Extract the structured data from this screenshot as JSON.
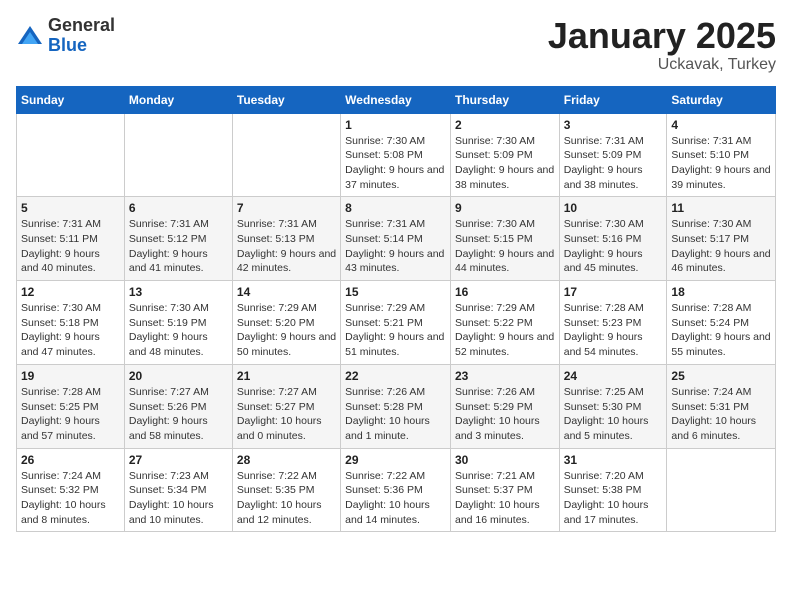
{
  "logo": {
    "general": "General",
    "blue": "Blue"
  },
  "title": "January 2025",
  "subtitle": "Uckavak, Turkey",
  "days_of_week": [
    "Sunday",
    "Monday",
    "Tuesday",
    "Wednesday",
    "Thursday",
    "Friday",
    "Saturday"
  ],
  "weeks": [
    [
      {
        "day": "",
        "info": ""
      },
      {
        "day": "",
        "info": ""
      },
      {
        "day": "",
        "info": ""
      },
      {
        "day": "1",
        "info": "Sunrise: 7:30 AM\nSunset: 5:08 PM\nDaylight: 9 hours and 37 minutes."
      },
      {
        "day": "2",
        "info": "Sunrise: 7:30 AM\nSunset: 5:09 PM\nDaylight: 9 hours and 38 minutes."
      },
      {
        "day": "3",
        "info": "Sunrise: 7:31 AM\nSunset: 5:09 PM\nDaylight: 9 hours and 38 minutes."
      },
      {
        "day": "4",
        "info": "Sunrise: 7:31 AM\nSunset: 5:10 PM\nDaylight: 9 hours and 39 minutes."
      }
    ],
    [
      {
        "day": "5",
        "info": "Sunrise: 7:31 AM\nSunset: 5:11 PM\nDaylight: 9 hours and 40 minutes."
      },
      {
        "day": "6",
        "info": "Sunrise: 7:31 AM\nSunset: 5:12 PM\nDaylight: 9 hours and 41 minutes."
      },
      {
        "day": "7",
        "info": "Sunrise: 7:31 AM\nSunset: 5:13 PM\nDaylight: 9 hours and 42 minutes."
      },
      {
        "day": "8",
        "info": "Sunrise: 7:31 AM\nSunset: 5:14 PM\nDaylight: 9 hours and 43 minutes."
      },
      {
        "day": "9",
        "info": "Sunrise: 7:30 AM\nSunset: 5:15 PM\nDaylight: 9 hours and 44 minutes."
      },
      {
        "day": "10",
        "info": "Sunrise: 7:30 AM\nSunset: 5:16 PM\nDaylight: 9 hours and 45 minutes."
      },
      {
        "day": "11",
        "info": "Sunrise: 7:30 AM\nSunset: 5:17 PM\nDaylight: 9 hours and 46 minutes."
      }
    ],
    [
      {
        "day": "12",
        "info": "Sunrise: 7:30 AM\nSunset: 5:18 PM\nDaylight: 9 hours and 47 minutes."
      },
      {
        "day": "13",
        "info": "Sunrise: 7:30 AM\nSunset: 5:19 PM\nDaylight: 9 hours and 48 minutes."
      },
      {
        "day": "14",
        "info": "Sunrise: 7:29 AM\nSunset: 5:20 PM\nDaylight: 9 hours and 50 minutes."
      },
      {
        "day": "15",
        "info": "Sunrise: 7:29 AM\nSunset: 5:21 PM\nDaylight: 9 hours and 51 minutes."
      },
      {
        "day": "16",
        "info": "Sunrise: 7:29 AM\nSunset: 5:22 PM\nDaylight: 9 hours and 52 minutes."
      },
      {
        "day": "17",
        "info": "Sunrise: 7:28 AM\nSunset: 5:23 PM\nDaylight: 9 hours and 54 minutes."
      },
      {
        "day": "18",
        "info": "Sunrise: 7:28 AM\nSunset: 5:24 PM\nDaylight: 9 hours and 55 minutes."
      }
    ],
    [
      {
        "day": "19",
        "info": "Sunrise: 7:28 AM\nSunset: 5:25 PM\nDaylight: 9 hours and 57 minutes."
      },
      {
        "day": "20",
        "info": "Sunrise: 7:27 AM\nSunset: 5:26 PM\nDaylight: 9 hours and 58 minutes."
      },
      {
        "day": "21",
        "info": "Sunrise: 7:27 AM\nSunset: 5:27 PM\nDaylight: 10 hours and 0 minutes."
      },
      {
        "day": "22",
        "info": "Sunrise: 7:26 AM\nSunset: 5:28 PM\nDaylight: 10 hours and 1 minute."
      },
      {
        "day": "23",
        "info": "Sunrise: 7:26 AM\nSunset: 5:29 PM\nDaylight: 10 hours and 3 minutes."
      },
      {
        "day": "24",
        "info": "Sunrise: 7:25 AM\nSunset: 5:30 PM\nDaylight: 10 hours and 5 minutes."
      },
      {
        "day": "25",
        "info": "Sunrise: 7:24 AM\nSunset: 5:31 PM\nDaylight: 10 hours and 6 minutes."
      }
    ],
    [
      {
        "day": "26",
        "info": "Sunrise: 7:24 AM\nSunset: 5:32 PM\nDaylight: 10 hours and 8 minutes."
      },
      {
        "day": "27",
        "info": "Sunrise: 7:23 AM\nSunset: 5:34 PM\nDaylight: 10 hours and 10 minutes."
      },
      {
        "day": "28",
        "info": "Sunrise: 7:22 AM\nSunset: 5:35 PM\nDaylight: 10 hours and 12 minutes."
      },
      {
        "day": "29",
        "info": "Sunrise: 7:22 AM\nSunset: 5:36 PM\nDaylight: 10 hours and 14 minutes."
      },
      {
        "day": "30",
        "info": "Sunrise: 7:21 AM\nSunset: 5:37 PM\nDaylight: 10 hours and 16 minutes."
      },
      {
        "day": "31",
        "info": "Sunrise: 7:20 AM\nSunset: 5:38 PM\nDaylight: 10 hours and 17 minutes."
      },
      {
        "day": "",
        "info": ""
      }
    ]
  ]
}
